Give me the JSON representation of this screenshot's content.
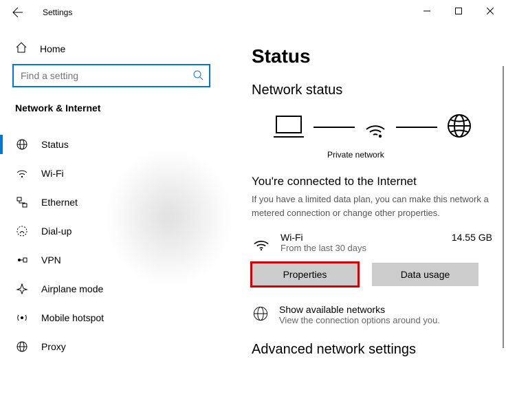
{
  "window": {
    "title": "Settings"
  },
  "sidebar": {
    "home": "Home",
    "search_placeholder": "Find a setting",
    "category": "Network & Internet",
    "items": [
      {
        "label": "Status",
        "icon": "status",
        "active": true
      },
      {
        "label": "Wi-Fi",
        "icon": "wifi",
        "active": false
      },
      {
        "label": "Ethernet",
        "icon": "ethernet",
        "active": false
      },
      {
        "label": "Dial-up",
        "icon": "dialup",
        "active": false
      },
      {
        "label": "VPN",
        "icon": "vpn",
        "active": false
      },
      {
        "label": "Airplane mode",
        "icon": "airplane",
        "active": false
      },
      {
        "label": "Mobile hotspot",
        "icon": "hotspot",
        "active": false
      },
      {
        "label": "Proxy",
        "icon": "proxy",
        "active": false
      }
    ]
  },
  "main": {
    "page_title": "Status",
    "network_status_heading": "Network status",
    "diagram_caption": "Private network",
    "connected_heading": "You're connected to the Internet",
    "connected_body": "If you have a limited data plan, you can make this network a metered connection or change other properties.",
    "connection": {
      "name": "Wi-Fi",
      "period": "From the last 30 days",
      "usage": "14.55 GB"
    },
    "buttons": {
      "properties": "Properties",
      "data_usage": "Data usage"
    },
    "show_networks": {
      "label": "Show available networks",
      "sub": "View the connection options around you."
    },
    "advanced_heading": "Advanced network settings"
  }
}
